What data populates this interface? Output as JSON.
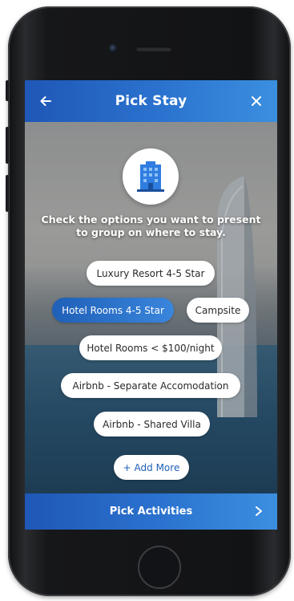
{
  "header": {
    "title": "Pick Stay",
    "back_icon": "arrow-left-icon",
    "close_icon": "close-icon"
  },
  "hero_icon": "hotel-building-icon",
  "prompt": {
    "line1": "Check the options you want to present",
    "line2": "to group on where to stay."
  },
  "options": [
    {
      "label": "Luxury Resort 4-5 Star",
      "selected": false
    },
    {
      "label": "Hotel Rooms 4-5 Star",
      "selected": true
    },
    {
      "label": "Campsite",
      "selected": false
    },
    {
      "label": "Hotel Rooms < $100/night",
      "selected": false
    },
    {
      "label": "Airbnb -  Separate Accomodation",
      "selected": false
    },
    {
      "label": "Airbnb - Shared Villa",
      "selected": false
    }
  ],
  "add_more_label": "+ Add More",
  "footer": {
    "label": "Pick Activities",
    "chevron_icon": "chevron-right-icon"
  },
  "colors": {
    "accent_start": "#1f57b6",
    "accent_end": "#3b8fe0",
    "chip_bg": "#ffffff",
    "chip_text": "#2a2a2a"
  }
}
